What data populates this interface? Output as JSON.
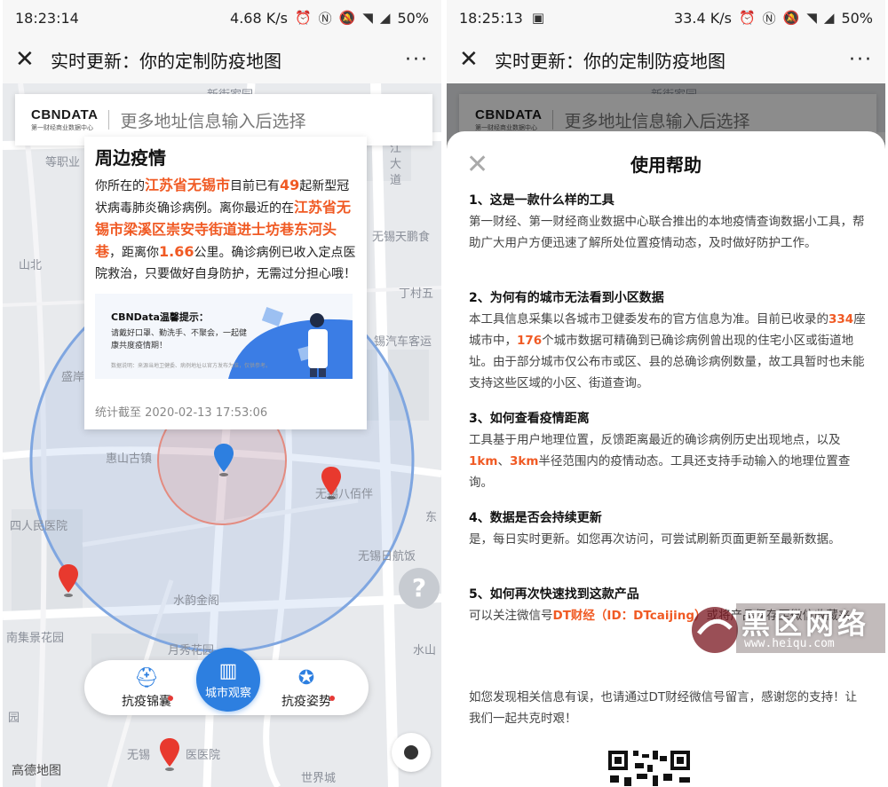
{
  "left": {
    "status": {
      "time": "18:23:14",
      "speed": "4.68 K/s",
      "battery": "50%"
    },
    "nav": {
      "close": "✕",
      "title": "实时更新：你的定制防疫地图",
      "more": "···"
    },
    "search": {
      "brand": "CBNDATA",
      "brand_sub": "第一财经商业数据中心",
      "placeholder": "更多地址信息输入后选择"
    },
    "map_labels": [
      "新街家园",
      "等职业",
      "江",
      "大",
      "道",
      "无锡天鹏食",
      "山北",
      "丁村五",
      "锡汽车客运",
      "盛岸",
      "惠山古镇",
      "无锡八佰伴",
      "东",
      "四人民医院",
      "无锡日航饭",
      "水韵金阁",
      "南集景花园",
      "月秀花园",
      "水山",
      "无锡",
      "医医院",
      "世界城",
      "园"
    ],
    "card": {
      "title": "周边疫情",
      "p1": "你所在的",
      "city": "江苏省无锡市",
      "p2": "目前已有",
      "count": "49",
      "p3": "起新型冠状病毒肺炎确诊病例。离你最近的在",
      "addr": "江苏省无锡市梁溪区崇安寺街道进士坊巷东河头巷",
      "p4": "，距离你",
      "dist": "1.66",
      "p5": "公里。确诊病例已收入定点医院救治，只要做好自身防护，无需过分担心哦！",
      "tip_title": "CBNData温馨提示：",
      "tip_body": "请戴好口罩、勤洗手、不聚会，一起健康共度疫情期！",
      "tip_note": "数据说明：来源当地卫健委、病例地址以官方发布为准，仅供参考。",
      "stamp": "统计截至 2020-02-13 17:53:06"
    },
    "bottom_nav": [
      {
        "label": "抗疫锦囊",
        "icon": "bag-icon"
      },
      {
        "label": "城市观察",
        "icon": "building-icon"
      },
      {
        "label": "抗疫姿势",
        "icon": "shield-icon"
      }
    ],
    "help": "?",
    "amap": "高德地图"
  },
  "right": {
    "status": {
      "time": "18:25:13",
      "speed": "33.4 K/s",
      "battery": "50%"
    },
    "nav": {
      "close": "✕",
      "title": "实时更新：你的定制防疫地图",
      "more": "···"
    },
    "map_labels": [
      "新街家园"
    ],
    "search": {
      "brand": "CBNDATA",
      "brand_sub": "第一财经商业数据中心",
      "placeholder": "更多地址信息输入后选择"
    },
    "sheet": {
      "close": "✕",
      "title": "使用帮助",
      "q1": "1、这是一款什么样的工具",
      "a1": "第一财经、第一财经商业数据中心联合推出的本地疫情查询数据小工具，帮助广大用户方便迅速了解所处位置疫情动态，及时做好防护工作。",
      "q2": "2、为何有的城市无法看到小区数据",
      "a2a": "本工具信息采集以各城市卫健委发布的官方信息为准。目前已收录的",
      "n334": "334",
      "a2b": "座城市中，",
      "n176": "176",
      "a2c": "个城市数据可精确到已确诊病例曾出现的住宅小区或街道地址。由于部分城市仅公布市或区、县的总确诊病例数量，故工具暂时也未能支持这些区域的小区、街道查询。",
      "q3": "3、如何查看疫情距离",
      "a3a": "工具基于用户地理位置，反馈距离最近的确诊病例历史出现地点，以及",
      "k1": "1km",
      "a3b": "、",
      "k3": "3km",
      "a3c": "半径范围内的疫情动态。工具还支持手动输入的地理位置查询。",
      "q4": "4、数据是否会持续更新",
      "a4": "是，每日实时更新。如您再次访问，可尝试刷新页面更新至最新数据。",
      "q5": "5、如何再次快速找到这款产品",
      "a5a": "可以关注微信号",
      "dt": "DT财经（ID：DTcaijing）",
      "a5b": "或将产品保存至微信收藏夹",
      "footer": "如您发现相关信息有误，也请通过DT财经微信号留言，感谢您的支持！让我们一起共克时艰！"
    },
    "watermark": {
      "text": "黑区网络",
      "url": "www.heiqu.com"
    }
  }
}
